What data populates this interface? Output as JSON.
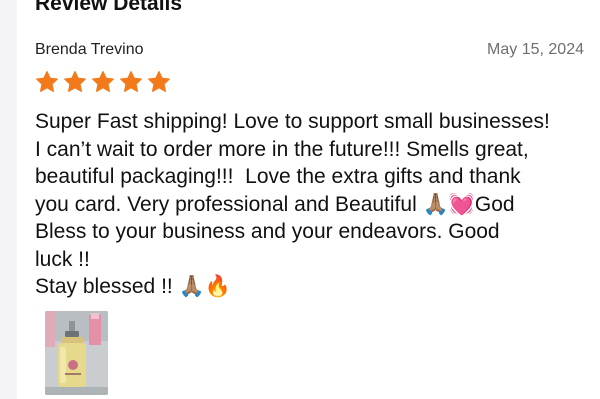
{
  "header": {
    "title": "Review Details"
  },
  "review": {
    "author": "Brenda Trevino",
    "date": "May 15, 2024",
    "rating": 5,
    "rating_max": 5,
    "star_color": "#f27a1a",
    "body": "Super Fast shipping! Love to support small businesses!\nI can’t wait to order more in the future!!! Smells great,\nbeautiful packaging!!!  Love the extra gifts and thank\nyou card. Very professional and Beautiful 🙏🏽💓God\nBless to your business and your endeavors. Good\nluck !!\nStay blessed !! 🙏🏽🔥",
    "photo_icon": "perfume-bottle-photo"
  }
}
